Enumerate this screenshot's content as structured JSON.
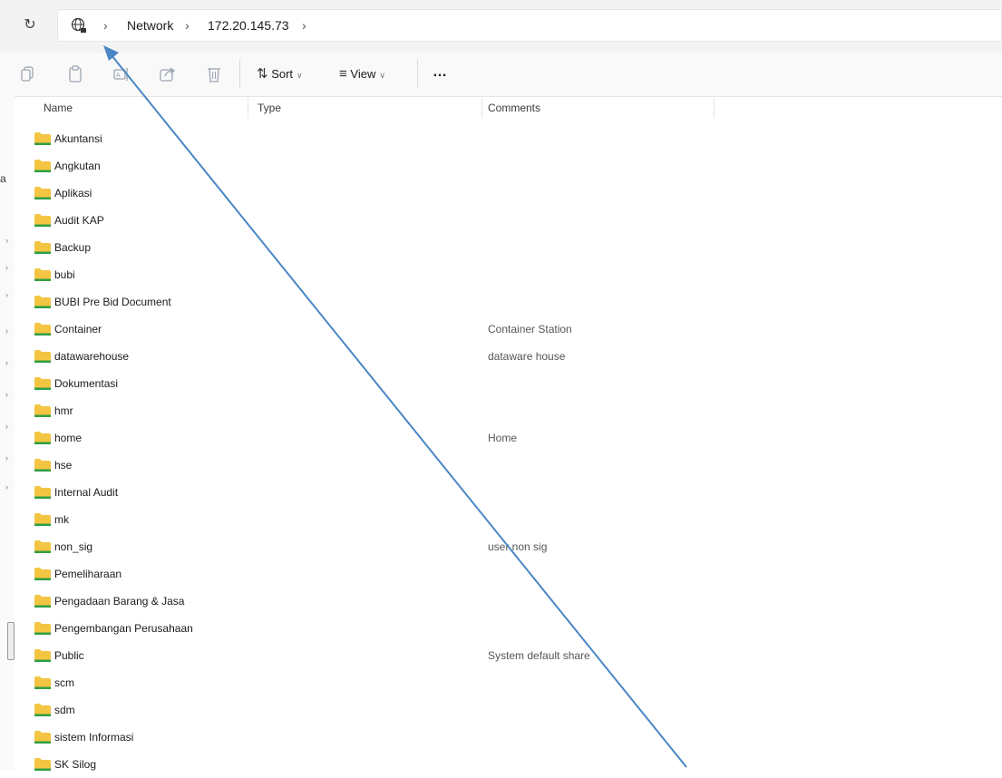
{
  "address_bar": {
    "crumbs": [
      "Network",
      "172.20.145.73"
    ],
    "globe_icon": "globe-network-icon",
    "refresh_icon": "refresh-icon"
  },
  "toolbar": {
    "sort_label": "Sort",
    "view_label": "View",
    "more_label": "…"
  },
  "left_pane": {
    "fragment_text": "a"
  },
  "columns": {
    "name": "Name",
    "type": "Type",
    "comments": "Comments"
  },
  "rows": [
    {
      "name": "Akuntansi",
      "comment": ""
    },
    {
      "name": "Angkutan",
      "comment": ""
    },
    {
      "name": "Aplikasi",
      "comment": ""
    },
    {
      "name": "Audit KAP",
      "comment": ""
    },
    {
      "name": "Backup",
      "comment": ""
    },
    {
      "name": "bubi",
      "comment": ""
    },
    {
      "name": "BUBI Pre Bid Document",
      "comment": ""
    },
    {
      "name": "Container",
      "comment": "Container Station"
    },
    {
      "name": "datawarehouse",
      "comment": "dataware house"
    },
    {
      "name": "Dokumentasi",
      "comment": ""
    },
    {
      "name": "hmr",
      "comment": ""
    },
    {
      "name": "home",
      "comment": "Home"
    },
    {
      "name": "hse",
      "comment": ""
    },
    {
      "name": "Internal Audit",
      "comment": ""
    },
    {
      "name": "mk",
      "comment": ""
    },
    {
      "name": "non_sig",
      "comment": "user non sig"
    },
    {
      "name": "Pemeliharaan",
      "comment": ""
    },
    {
      "name": "Pengadaan Barang & Jasa",
      "comment": ""
    },
    {
      "name": "Pengembangan Perusahaan",
      "comment": ""
    },
    {
      "name": "Public",
      "comment": "System default share"
    },
    {
      "name": "scm",
      "comment": ""
    },
    {
      "name": "sdm",
      "comment": ""
    },
    {
      "name": "sistem Informasi",
      "comment": ""
    },
    {
      "name": "SK Silog",
      "comment": ""
    }
  ],
  "colors": {
    "folder_body": "#f4c542",
    "folder_accent": "#2f9e44",
    "annotation_arrow": "#4a86c4"
  }
}
